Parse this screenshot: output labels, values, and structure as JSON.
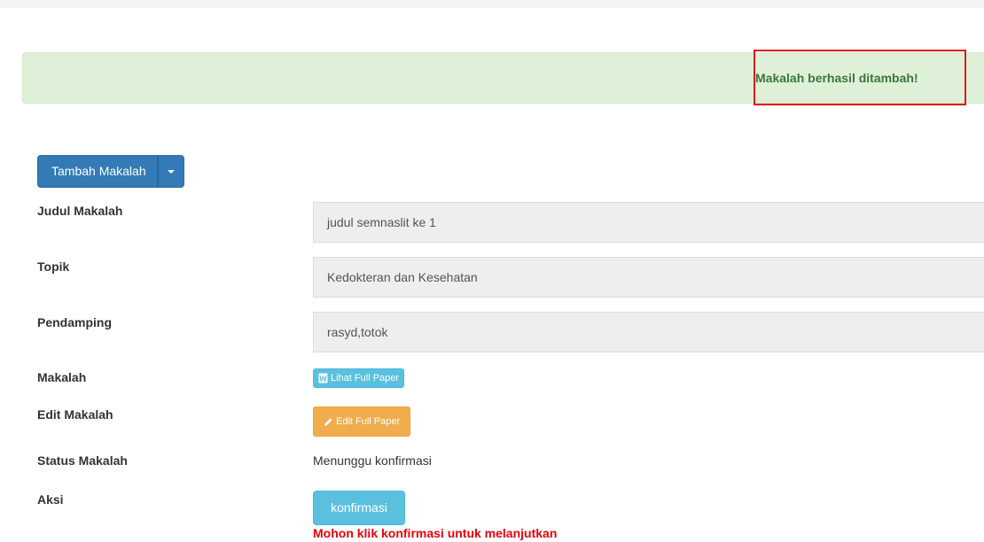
{
  "alert": {
    "message": "Makalah berhasil ditambah!",
    "highlight_color": "#e0141e"
  },
  "toolbar": {
    "add_button_label": "Tambah Makalah",
    "dropdown_icon": "caret-down-icon"
  },
  "form": {
    "title_label": "Judul Makalah",
    "title_value": "judul semnaslit ke 1",
    "topic_label": "Topik",
    "topic_value": "Kedokteran dan Kesehatan",
    "companion_label": "Pendamping",
    "companion_value": "rasyd,totok",
    "paper_label": "Makalah",
    "view_paper_button": "Lihat Full Paper",
    "view_paper_icon": "word-document-icon",
    "edit_paper_label": "Edit Makalah",
    "edit_paper_button": "Edit Full Paper",
    "edit_paper_icon": "pencil-icon",
    "status_label": "Status Makalah",
    "status_value": "Menunggu konfirmasi",
    "action_label": "Aksi",
    "confirm_button": "konfirmasi",
    "confirm_hint": "Mohon klik konfirmasi untuk melanjutkan"
  },
  "colors": {
    "primary": "#337ab7",
    "info": "#5bc0de",
    "warning": "#f0ad4e",
    "success_bg": "#dff0d8",
    "success_text": "#3c763d",
    "danger_text": "#e8000b"
  }
}
